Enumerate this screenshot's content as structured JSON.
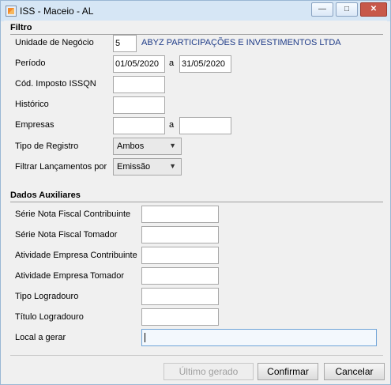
{
  "window": {
    "title": "ISS - Maceio - AL",
    "minimize_icon": "minimize-icon",
    "maximize_icon": "maximize-icon",
    "close_icon": "close-icon"
  },
  "filtro": {
    "title": "Filtro",
    "unidade_label": "Unidade de Negócio",
    "unidade_value": "5",
    "unidade_name": "ABYZ PARTICIPAÇÕES E INVESTIMENTOS LTDA",
    "periodo_label": "Período",
    "periodo_start": "01/05/2020",
    "periodo_sep": "a",
    "periodo_end": "31/05/2020",
    "cod_imposto_label": "Cód. Imposto ISSQN",
    "cod_imposto_value": "",
    "historico_label": "Histórico",
    "historico_value": "",
    "empresas_label": "Empresas",
    "empresas_from": "",
    "empresas_sep": "a",
    "empresas_to": "",
    "tipo_registro_label": "Tipo de Registro",
    "tipo_registro_value": "Ambos",
    "filtrar_label": "Filtrar Lançamentos por",
    "filtrar_value": "Emissão"
  },
  "dados": {
    "title": "Dados Auxiliares",
    "serie_contrib_label": "Série Nota Fiscal Contribuinte",
    "serie_contrib_value": "",
    "serie_tomador_label": "Série Nota Fiscal Tomador",
    "serie_tomador_value": "",
    "ativ_contrib_label": "Atividade Empresa Contribuinte",
    "ativ_contrib_value": "",
    "ativ_tomador_label": "Atividade Empresa Tomador",
    "ativ_tomador_value": "",
    "tipo_logradouro_label": "Tipo Logradouro",
    "tipo_logradouro_value": "",
    "titulo_logradouro_label": "Título Logradouro",
    "titulo_logradouro_value": "",
    "local_label": "Local a gerar",
    "local_value": ""
  },
  "footer": {
    "ultimo_gerado": "Último gerado",
    "confirmar": "Confirmar",
    "cancelar": "Cancelar"
  },
  "colors": {
    "titlebar": "#d6e6f5",
    "close_button": "#c7584a",
    "unit_name_text": "#1f3c88",
    "focused_input_border": "#6fa3d7"
  }
}
